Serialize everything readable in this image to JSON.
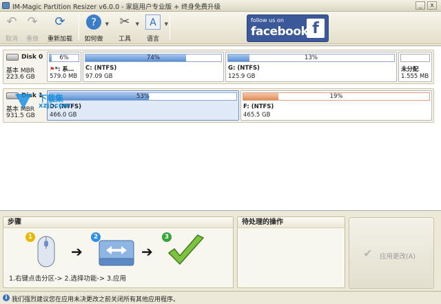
{
  "window": {
    "title": "IM-Magic Partition Resizer v6.0.0 - 家庭用户专业版 + 终身免费升级",
    "minimize": "_",
    "close": "x"
  },
  "toolbar": {
    "undo": "取消",
    "redo": "重做",
    "reload": "重新加载",
    "howto": "如何做",
    "tools": "工具",
    "language": "语言"
  },
  "facebook": {
    "small": "follow us on",
    "big": "facebook",
    "f": "f"
  },
  "disks": [
    {
      "name": "Disk 0",
      "type": "基本 MBR",
      "size": "223.6 GB",
      "partitions": [
        {
          "pct": "6%",
          "fill": 0.06,
          "name": "*: 系…",
          "size": "579.0 MB"
        },
        {
          "pct": "74%",
          "fill": 0.74,
          "name": "C: (NTFS)",
          "size": "97.09 GB"
        },
        {
          "pct": "13%",
          "fill": 0.13,
          "name": "G: (NTFS)",
          "size": "125.9 GB"
        },
        {
          "pct": "",
          "fill": 0,
          "name": "未分配",
          "size": "1.555 MB"
        }
      ]
    },
    {
      "name": "Disk 1",
      "type": "基本 MBR",
      "size": "931.5 GB",
      "partitions": [
        {
          "pct": "53%",
          "fill": 0.53,
          "name": "D: (NTFS)",
          "size": "466.0 GB"
        },
        {
          "pct": "19%",
          "fill": 0.19,
          "name": "F: (NTFS)",
          "size": "465.5 GB"
        }
      ]
    }
  ],
  "watermark": {
    "line1": "下载集",
    "line2": "xzji.com"
  },
  "steps_panel": {
    "title": "步骤",
    "badges": [
      "1",
      "2",
      "3"
    ],
    "instructions": "1.右键点击分区-> 2.选择功能-> 3.应用"
  },
  "pending_panel": {
    "title": "待处理的操作"
  },
  "apply_button": {
    "label": "应用更改(A)"
  },
  "status": {
    "text": "我们强烈建议您在应用未决更改之前关闭所有其他应用程序。"
  },
  "colors": {
    "bar_blue": "#5b8fd2",
    "bar_orange": "#e08c5a",
    "facebook": "#3b5998"
  }
}
